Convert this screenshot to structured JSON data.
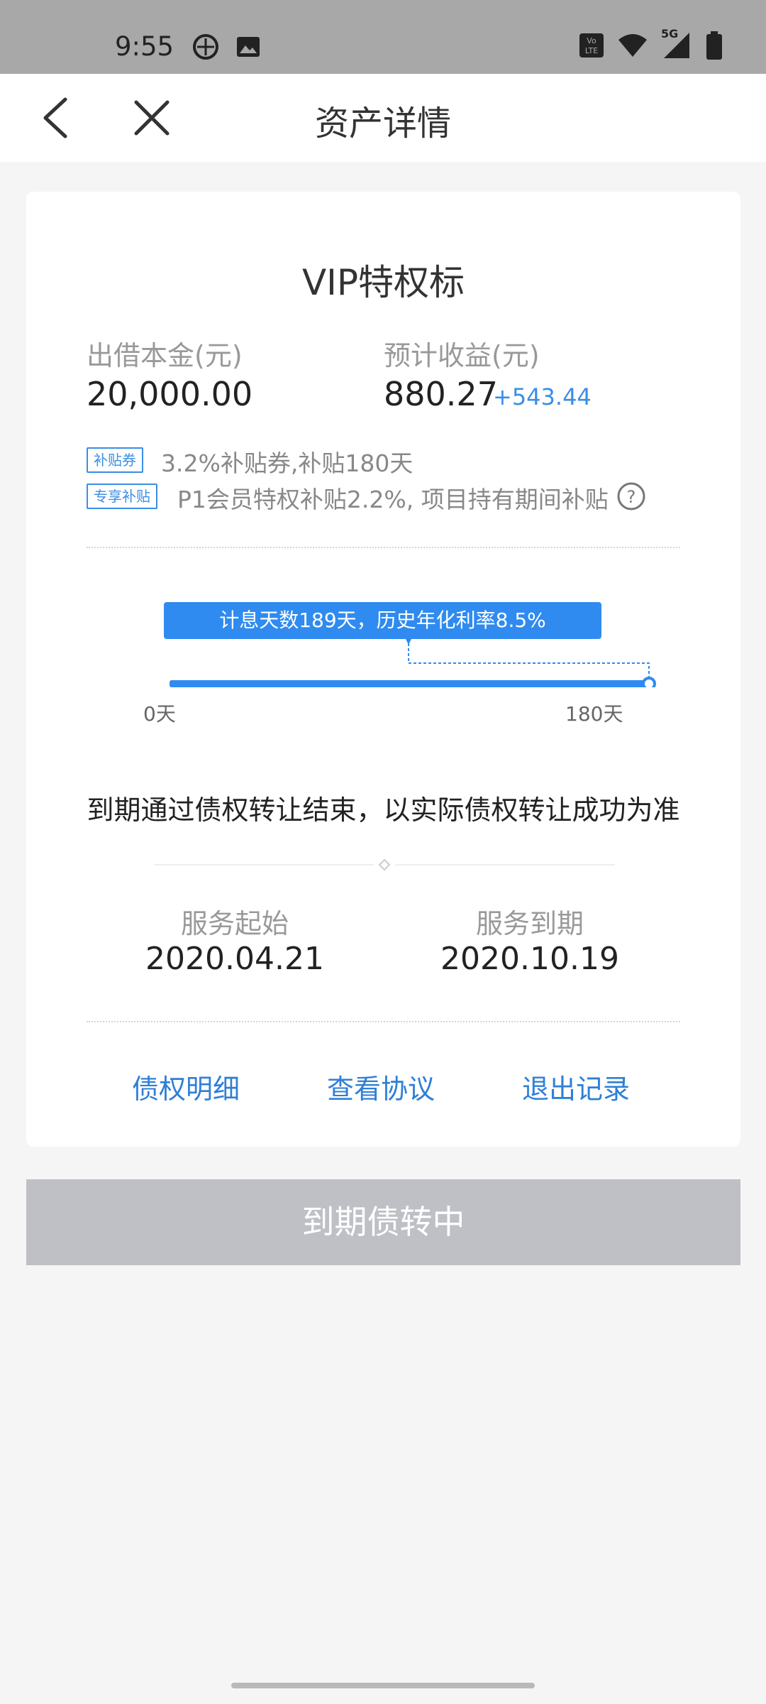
{
  "status_bar": {
    "time": "9:55",
    "icons_left": [
      "vpn-shield-icon",
      "image-icon"
    ],
    "icons_right": [
      "volte-icon",
      "wifi-icon",
      "5g-signal-icon",
      "battery-icon"
    ],
    "network_label": "5G"
  },
  "header": {
    "title": "资产详情",
    "back_icon": "chevron-left-icon",
    "close_icon": "close-icon"
  },
  "card": {
    "title": "VIP特权标",
    "principal": {
      "label": "出借本金(元)",
      "value": "20,000.00"
    },
    "income": {
      "label": "预计收益(元)",
      "value": "880.27",
      "extra": "+543.44"
    },
    "tags": [
      {
        "tag": "补贴券",
        "text": "3.2%补贴券,补贴180天"
      },
      {
        "tag": "专享补贴",
        "text": "P1会员特权补贴2.2%, 项目持有期间补贴"
      }
    ],
    "progress": {
      "tooltip": "计息天数189天，历史年化利率8.5%",
      "start_label": "0天",
      "end_label": "180天",
      "fraction": 1.0
    },
    "note": "到期通过债权转让结束，以实际债权转让成功为准",
    "service_start": {
      "label": "服务起始",
      "value": "2020.04.21"
    },
    "service_end": {
      "label": "服务到期",
      "value": "2020.10.19"
    },
    "links": [
      "债权明细",
      "查看协议",
      "退出记录"
    ]
  },
  "bottom_button": "到期债转中",
  "colors": {
    "accent": "#2f8bf0",
    "link": "#2f7fd6",
    "disabled_button": "#bfc0c6",
    "status_bar": "#a8a8a8"
  }
}
